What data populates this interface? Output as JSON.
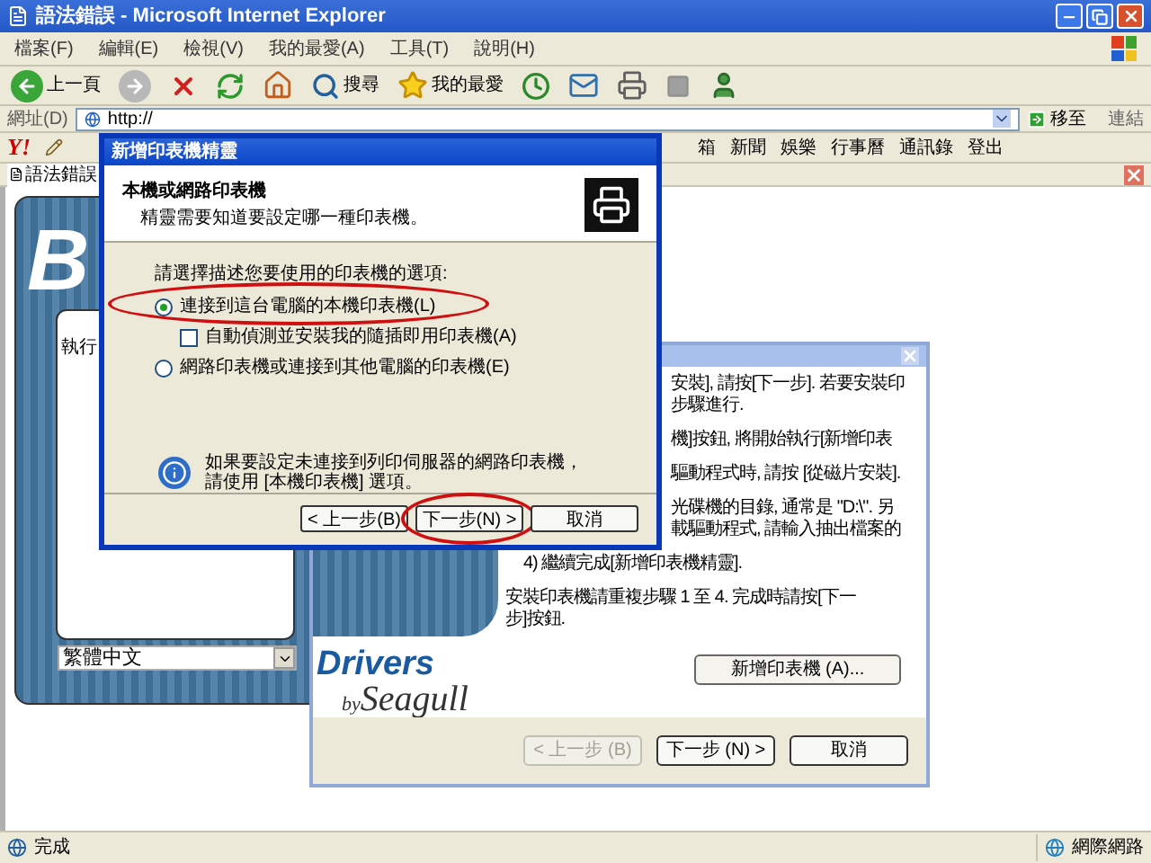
{
  "window": {
    "title": "語法錯誤 - Microsoft Internet Explorer"
  },
  "menu": [
    "檔案(F)",
    "編輯(E)",
    "檢視(V)",
    "我的最愛(A)",
    "工具(T)",
    "說明(H)"
  ],
  "toolbar": [
    {
      "kind": "back",
      "label": "上一頁"
    },
    {
      "kind": "forward"
    },
    {
      "kind": "stop"
    },
    {
      "kind": "refresh"
    },
    {
      "kind": "home"
    },
    {
      "kind": "search",
      "label": "搜尋"
    },
    {
      "kind": "favorites",
      "label": "我的最愛"
    },
    {
      "kind": "history"
    },
    {
      "kind": "mail"
    },
    {
      "kind": "print"
    },
    {
      "kind": "edit"
    },
    {
      "kind": "messenger"
    }
  ],
  "address": {
    "label": "網址(D)",
    "value": "http://",
    "go": "移至",
    "links": "連結"
  },
  "yahoo_toolbar": {
    "logo": "Y!",
    "items": [
      "箱",
      "新聞",
      "娛樂",
      "行事曆",
      "通訊錄",
      "登出"
    ]
  },
  "tab": {
    "label": "語法錯誤"
  },
  "page": {
    "logo": "B",
    "run_label": "執行",
    "language": "繁體中文"
  },
  "seagull_wizard": {
    "paragraphs": [
      {
        "kind": "covered",
        "lines": [
          "安裝], 請按[下一步]. 若要安裝印",
          "步驟進行."
        ]
      },
      {
        "kind": "covered",
        "lines": [
          "機]按鈕, 將開始執行[新增印表"
        ]
      },
      {
        "kind": "covered",
        "lines": [
          "驅動程式時, 請按 [從磁片安裝]."
        ]
      },
      {
        "kind": "covered",
        "lines": [
          "光碟機的目錄, 通常是 \"D:\\\". 另",
          "載驅動程式, 請輸入抽出檔案的"
        ]
      },
      {
        "kind": "step",
        "lines": [
          "4) 繼續完成[新增印表機精靈]."
        ]
      },
      {
        "kind": "plain",
        "lines": [
          "安裝印表機請重複步驟 1 至 4. 完成時請按[下一",
          "步]按鈕."
        ]
      }
    ],
    "logo": {
      "top": "Drivers",
      "bottom": "Seagull",
      "by": "by"
    },
    "add_button": "新增印表機 (A)...",
    "buttons": [
      {
        "label": "< 上一步 (B)",
        "disabled": true
      },
      {
        "label": "下一步 (N) >",
        "disabled": false
      },
      {
        "label": "取消",
        "disabled": false
      }
    ]
  },
  "add_printer_wizard": {
    "title": "新增印表機精靈",
    "heading": "本機或網路印表機",
    "subheading": "精靈需要知道要設定哪一種印表機。",
    "prompt": "請選擇描述您要使用的印表機的選項:",
    "options": [
      {
        "kind": "radio",
        "label": "連接到這台電腦的本機印表機(L)",
        "selected": true,
        "highlighted": true
      },
      {
        "kind": "checkbox",
        "label": "自動偵測並安裝我的隨插即用印表機(A)",
        "checked": false
      },
      {
        "kind": "radio",
        "label": "網路印表機或連接到其他電腦的印表機(E)",
        "selected": false,
        "highlighted": false
      }
    ],
    "info": [
      "如果要設定未連接到列印伺服器的網路印表機，",
      "請使用 [本機印表機] 選項。"
    ],
    "buttons": [
      {
        "label": "< 上一步(B)",
        "highlighted": false
      },
      {
        "label": "下一步(N) >",
        "highlighted": true
      },
      {
        "label": "取消",
        "highlighted": false
      }
    ]
  },
  "status_bar": {
    "text": "完成",
    "zone": "網際網路"
  }
}
